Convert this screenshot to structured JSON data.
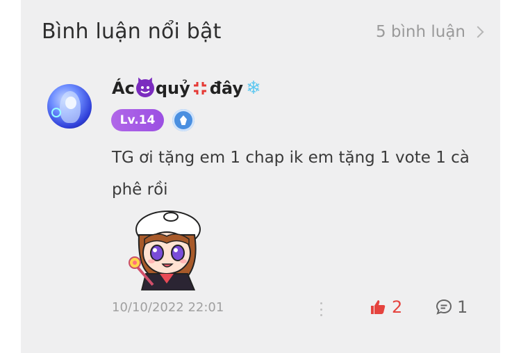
{
  "header": {
    "title": "Bình luận nổi bật",
    "count_label": "5 bình luận"
  },
  "comment": {
    "username_parts": [
      "Ác",
      "quỷ",
      "đây"
    ],
    "username_emojis": [
      "smiling-devil-icon",
      "anger-icon",
      "snowflake-icon"
    ],
    "level": "Lv.14",
    "text": "TG ơi tặng em 1 chap ik em tặng 1 vote 1 cà phê  rồi",
    "date": "10/10/2022 22:01",
    "like_count": "2",
    "reply_count": "1"
  },
  "colors": {
    "panel_bg": "#efeff0",
    "level_badge": "#a95ce6",
    "like": "#e5433e",
    "rank_badge": "#4a8fe0"
  }
}
